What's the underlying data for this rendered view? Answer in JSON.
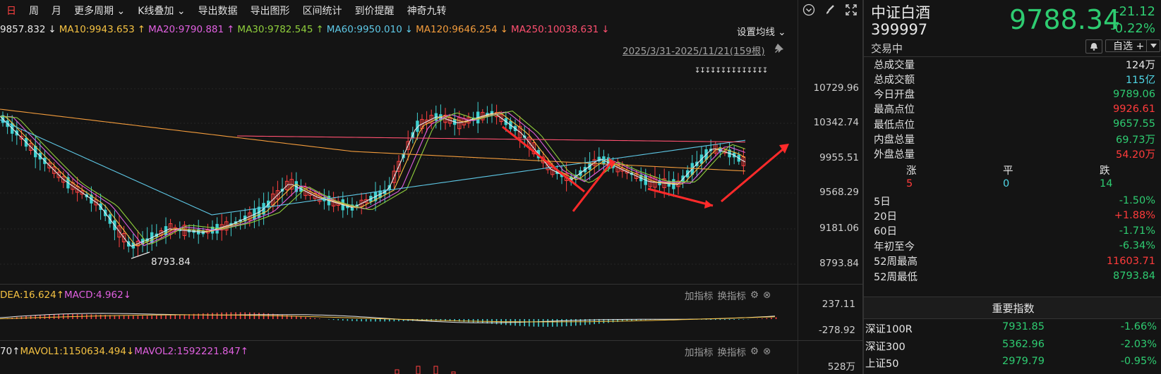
{
  "toolbar": {
    "items": [
      "日",
      "周",
      "月",
      "更多周期",
      "K线叠加",
      "导出数据",
      "导出图形",
      "区间统计",
      "到价提醒",
      "神奇九转"
    ]
  },
  "ma_line": [
    {
      "text": "9857.832",
      "color": "#e8e8e8"
    },
    {
      "text": "↓",
      "color": "#e8e8e8"
    },
    {
      "text": "MA10:9943.653",
      "color": "#f5c242"
    },
    {
      "text": "↑",
      "color": "#f5c242"
    },
    {
      "text": "MA20:9790.881",
      "color": "#e060e0"
    },
    {
      "text": "↑",
      "color": "#e060e0"
    },
    {
      "text": "MA30:9782.545",
      "color": "#8fce3c"
    },
    {
      "text": "↑",
      "color": "#8fce3c"
    },
    {
      "text": "MA60:9950.010",
      "color": "#5ec8e6"
    },
    {
      "text": "↓",
      "color": "#5ec8e6"
    },
    {
      "text": "MA120:9646.254",
      "color": "#f39c3c"
    },
    {
      "text": "↓",
      "color": "#f39c3c"
    },
    {
      "text": "MA250:10038.631",
      "color": "#ff5070"
    },
    {
      "text": "↓",
      "color": "#ff5070"
    }
  ],
  "ma_setting": "设置均线",
  "date_range": "2025/3/31-2025/11/21(159根)",
  "price_axis": [
    "10729.96",
    "10342.74",
    "9955.51",
    "9568.29",
    "9181.06",
    "8793.84"
  ],
  "low_label": "8793.84",
  "macd_line": [
    {
      "text": "DEA:16.624",
      "color": "#f5c242"
    },
    {
      "text": "↑",
      "color": "#f5c242"
    },
    {
      "text": "MACD:4.962",
      "color": "#e060e0"
    },
    {
      "text": "↓",
      "color": "#e060e0"
    }
  ],
  "macd_axis": [
    "237.11",
    "-278.92"
  ],
  "add_indicator": "加指标",
  "change_indicator": "换指标",
  "vol_line": [
    {
      "text": "70",
      "color": "#e8e8e8"
    },
    {
      "text": "↑",
      "color": "#e8e8e8"
    },
    {
      "text": "MAVOL1:1150634.494",
      "color": "#f5c242"
    },
    {
      "text": "↓",
      "color": "#f5c242"
    },
    {
      "text": "MAVOL2:1592221.847",
      "color": "#e060e0"
    },
    {
      "text": "↑",
      "color": "#e060e0"
    }
  ],
  "vol_axis": "528万",
  "panel": {
    "name": "中证白酒",
    "code": "399997",
    "status": "交易中",
    "price": "9788.34",
    "change": "-21.12",
    "change_pct": "-0.22%",
    "watch_label": "自选 +",
    "stats": [
      {
        "label": "总成交量",
        "value": "124万",
        "color": "white"
      },
      {
        "label": "总成交额",
        "value": "115亿",
        "color": "cyan"
      },
      {
        "label": "今日开盘",
        "value": "9789.06",
        "color": "green"
      },
      {
        "label": "最高点位",
        "value": "9926.61",
        "color": "red"
      },
      {
        "label": "最低点位",
        "value": "9657.55",
        "color": "green"
      },
      {
        "label": "内盘总量",
        "value": "69.73万",
        "color": "green"
      },
      {
        "label": "外盘总量",
        "value": "54.20万",
        "color": "red"
      }
    ],
    "breadth_labels": [
      "涨",
      "平",
      "跌"
    ],
    "breadth_values": [
      "5",
      "0",
      "14"
    ],
    "periods": [
      {
        "label": "5日",
        "value": "-1.50%",
        "color": "green"
      },
      {
        "label": "20日",
        "value": "+1.88%",
        "color": "red"
      },
      {
        "label": "60日",
        "value": "-1.71%",
        "color": "green"
      },
      {
        "label": "年初至今",
        "value": "-6.34%",
        "color": "green"
      },
      {
        "label": "52周最高",
        "value": "11603.71",
        "color": "red"
      },
      {
        "label": "52周最低",
        "value": "8793.84",
        "color": "green"
      }
    ],
    "index_title": "重要指数",
    "indices": [
      {
        "name": "深证100R",
        "value": "7931.85",
        "pct": "-1.66%"
      },
      {
        "name": "深证300",
        "value": "5362.96",
        "pct": "-2.03%"
      },
      {
        "name": "上证50",
        "value": "2979.79",
        "pct": "-0.95%"
      }
    ]
  }
}
